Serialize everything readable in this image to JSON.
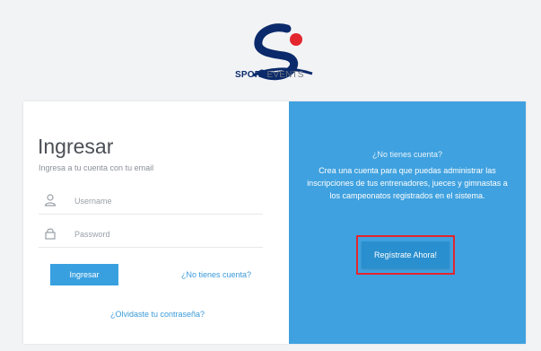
{
  "brand": {
    "bold": "SPORT",
    "light": "EVENTS",
    "colors": {
      "navy": "#0b2a6b",
      "red": "#e3262e",
      "blue": "#3fa1df"
    }
  },
  "login": {
    "title": "Ingresar",
    "subtitle": "Ingresa a tu cuenta con tu email",
    "username_placeholder": "Username",
    "password_placeholder": "Password",
    "username_icon": "user-icon",
    "password_icon": "lock-icon",
    "submit_label": "Ingresar",
    "no_account_link": "¿No tienes cuenta?",
    "forgot_link": "¿Olvidaste tu contraseña?"
  },
  "register": {
    "title": "¿No tienes cuenta?",
    "body": "Crea una cuenta para que puedas administrar las inscripciones de tus entrenadores, jueces y gimnastas a los campeonatos registrados en el sistema.",
    "cta_label": "Regístrate Ahora!"
  }
}
